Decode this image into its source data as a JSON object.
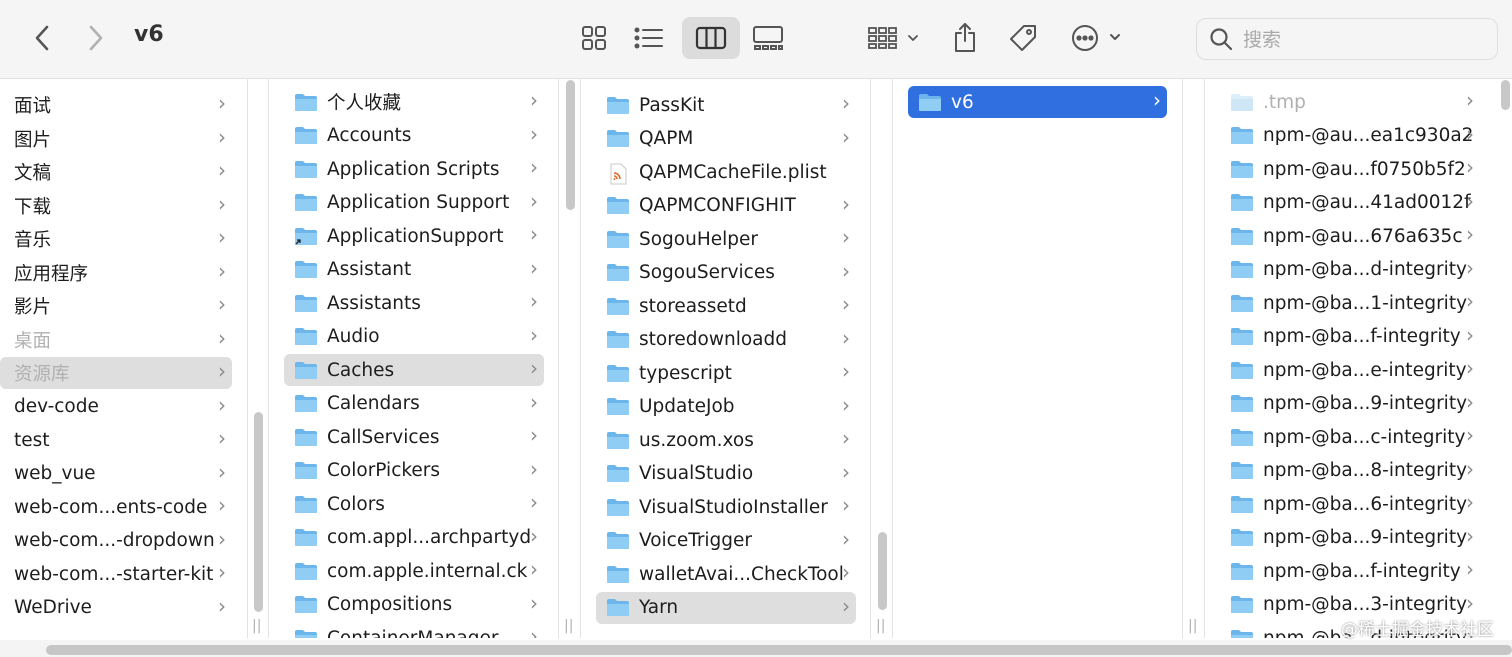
{
  "window": {
    "title": "v6"
  },
  "toolbar": {
    "search_placeholder": "搜索",
    "accent": "#2f6fdf"
  },
  "columns": [
    {
      "items": [
        {
          "name": "面试"
        },
        {
          "name": "图片"
        },
        {
          "name": "文稿"
        },
        {
          "name": "下载"
        },
        {
          "name": "音乐"
        },
        {
          "name": "应用程序"
        },
        {
          "name": "影片"
        },
        {
          "name": "桌面",
          "dim": true
        },
        {
          "name": "资源库",
          "dim": true,
          "selected": true
        },
        {
          "name": "dev-code"
        },
        {
          "name": "test"
        },
        {
          "name": "web_vue"
        },
        {
          "name": "web-com...ents-code"
        },
        {
          "name": "web-com...-dropdown"
        },
        {
          "name": "web-com...-starter-kit"
        },
        {
          "name": "WeDrive"
        }
      ]
    },
    {
      "items": [
        {
          "name": "个人收藏"
        },
        {
          "name": "Accounts"
        },
        {
          "name": "Application Scripts"
        },
        {
          "name": "Application Support"
        },
        {
          "name": "ApplicationSupport",
          "alias": true
        },
        {
          "name": "Assistant"
        },
        {
          "name": "Assistants"
        },
        {
          "name": "Audio"
        },
        {
          "name": "Caches",
          "selected": true
        },
        {
          "name": "Calendars"
        },
        {
          "name": "CallServices"
        },
        {
          "name": "ColorPickers"
        },
        {
          "name": "Colors"
        },
        {
          "name": "com.appl...archpartyd"
        },
        {
          "name": "com.apple.internal.ck"
        },
        {
          "name": "Compositions"
        },
        {
          "name": "ContainerManager"
        }
      ]
    },
    {
      "items": [
        {
          "name": "PassKit"
        },
        {
          "name": "QAPM"
        },
        {
          "name": "QAPMCacheFile.plist",
          "file": true
        },
        {
          "name": "QAPMCONFIGHIT"
        },
        {
          "name": "SogouHelper"
        },
        {
          "name": "SogouServices"
        },
        {
          "name": "storeassetd"
        },
        {
          "name": "storedownloadd"
        },
        {
          "name": "typescript"
        },
        {
          "name": "UpdateJob"
        },
        {
          "name": "us.zoom.xos"
        },
        {
          "name": "VisualStudio"
        },
        {
          "name": "VisualStudioInstaller"
        },
        {
          "name": "VoiceTrigger"
        },
        {
          "name": "walletAvai...CheckTool"
        },
        {
          "name": "Yarn",
          "selected": true
        }
      ]
    },
    {
      "items": [
        {
          "name": "v6",
          "active": true
        }
      ]
    },
    {
      "items": [
        {
          "name": ".tmp",
          "dim": true
        },
        {
          "name": "npm-@au...ea1c930a2"
        },
        {
          "name": "npm-@au...f0750b5f2"
        },
        {
          "name": "npm-@au...41ad0012f"
        },
        {
          "name": "npm-@au...676a635c"
        },
        {
          "name": "npm-@ba...d-integrity"
        },
        {
          "name": "npm-@ba...1-integrity"
        },
        {
          "name": "npm-@ba...f-integrity"
        },
        {
          "name": "npm-@ba...e-integrity"
        },
        {
          "name": "npm-@ba...9-integrity"
        },
        {
          "name": "npm-@ba...c-integrity"
        },
        {
          "name": "npm-@ba...8-integrity"
        },
        {
          "name": "npm-@ba...6-integrity"
        },
        {
          "name": "npm-@ba...9-integrity"
        },
        {
          "name": "npm-@ba...f-integrity"
        },
        {
          "name": "npm-@ba...3-integrity"
        },
        {
          "name": "npm-@ba...d-integrity"
        }
      ]
    }
  ],
  "watermark": "@稀土掘金技术社区"
}
